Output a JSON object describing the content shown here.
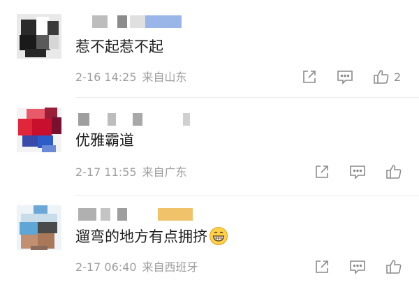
{
  "comments": [
    {
      "text": "惹不起惹不起",
      "date": "2-16 14:25",
      "location": "来自山东",
      "like_count": "2"
    },
    {
      "text": "优雅霸道",
      "date": "2-17 11:55",
      "location": "来自广东"
    },
    {
      "text": "遛弯的地方有点拥挤",
      "date": "2-17 06:40",
      "location": "来自西班牙"
    }
  ],
  "icons": {
    "share": "share-icon",
    "comment": "comment-icon",
    "like": "like-icon",
    "emoji": "grinning-face-emoji"
  },
  "colors": {
    "text": "#1f1f1f",
    "meta": "#9e9e9e",
    "icon": "#8a8a8a"
  }
}
